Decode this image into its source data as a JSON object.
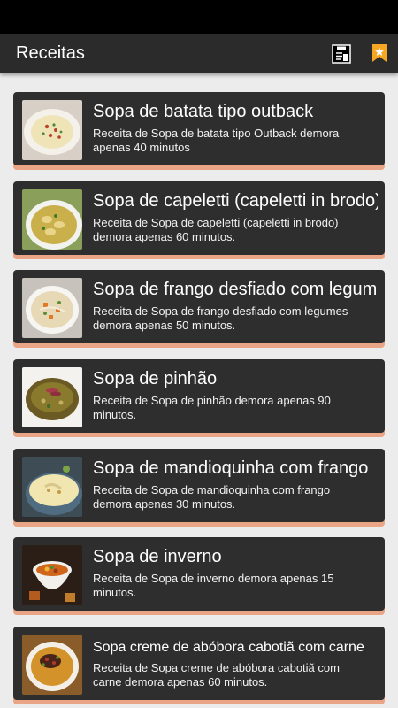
{
  "appbar": {
    "title": "Receitas",
    "icons": [
      "clipboard-icon",
      "bookmark-icon"
    ],
    "accent": "#f5a623"
  },
  "recipes": [
    {
      "title": "Sopa de batata tipo outback",
      "description": "Receita de Sopa de batata tipo Outback demora apenas 40 minutos"
    },
    {
      "title": "Sopa de capeletti (capeletti in brodo)",
      "description": "Receita de Sopa de capeletti (capeletti in brodo) demora apenas 60 minutos."
    },
    {
      "title": "Sopa de frango desfiado com legumes",
      "description": "Receita de Sopa de frango desfiado com legumes demora apenas 50 minutos."
    },
    {
      "title": "Sopa de pinhão",
      "description": "Receita de Sopa de pinhão demora apenas 90 minutos."
    },
    {
      "title": "Sopa de mandioquinha com frango",
      "description": "Receita de Sopa de mandioquinha com frango demora apenas 30 minutos."
    },
    {
      "title": "Sopa de inverno",
      "description": "Receita de Sopa de inverno demora apenas 15 minutos."
    },
    {
      "title": "Sopa creme de abóbora cabotiã com carne",
      "description": "Receita de Sopa creme de abóbora cabotiã com carne demora apenas 60 minutos."
    }
  ],
  "colors": {
    "card": "#2e2e2e",
    "card_accent": "#e9a585",
    "appbar": "#2b2b2b",
    "background": "#ececec"
  }
}
